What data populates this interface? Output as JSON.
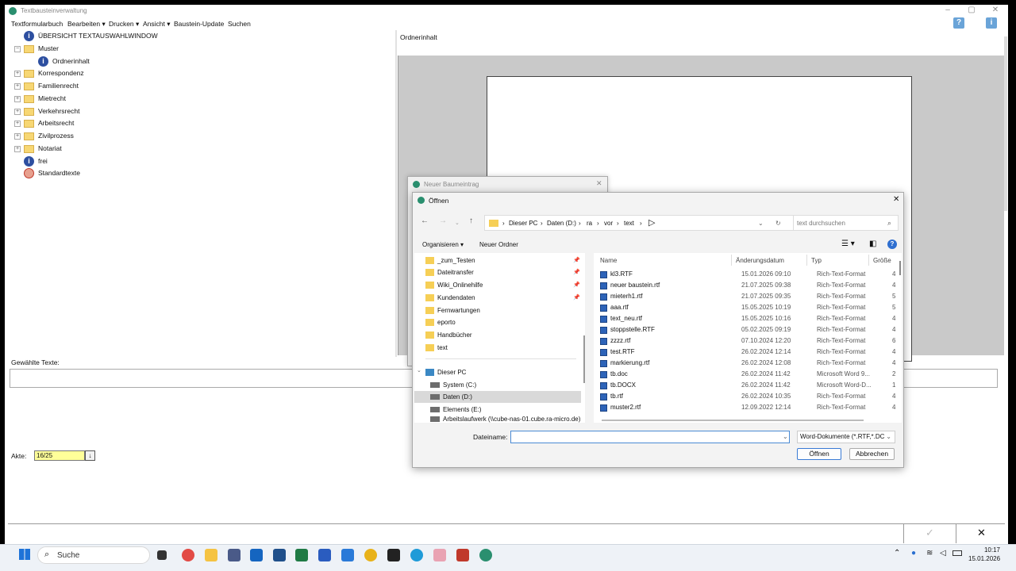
{
  "app": {
    "title": "Textbausteinverwaltung",
    "menu": [
      "Textformularbuch",
      "Bearbeiten ▾",
      "Drucken ▾",
      "Ansicht ▾",
      "Baustein-Update",
      "Suchen"
    ],
    "tree": [
      {
        "label": "ÜBERSICHT TEXTAUSWAHLWINDOW",
        "icon": "info-icon"
      },
      {
        "label": "Muster",
        "icon": "folder-open-icon"
      },
      {
        "label": "Ordnerinhalt",
        "icon": "info-icon"
      },
      {
        "label": "Korrespondenz",
        "icon": "folder-icon"
      },
      {
        "label": "Familienrecht",
        "icon": "folder-icon"
      },
      {
        "label": "Mietrecht",
        "icon": "folder-icon"
      },
      {
        "label": "Verkehrsrecht",
        "icon": "folder-icon"
      },
      {
        "label": "Arbeitsrecht",
        "icon": "folder-icon"
      },
      {
        "label": "Zivilprozess",
        "icon": "folder-icon"
      },
      {
        "label": "Notariat",
        "icon": "folder-icon"
      },
      {
        "label": "frei",
        "icon": "info-icon"
      },
      {
        "label": "Standardtexte",
        "icon": "standard-texts-icon"
      }
    ],
    "right_title": "Ordnerinhalt",
    "selected_label": "Gewählte Texte:",
    "akte_label": "Akte:",
    "akte_value": "16/25"
  },
  "nbe_window": {
    "title": "Neuer Baumeintrag"
  },
  "dialog": {
    "title": "Öffnen",
    "path": [
      "Dieser PC",
      "Daten (D:)",
      "ra",
      "vor",
      "text"
    ],
    "search_placeholder": "text durchsuchen",
    "organize": "Organisieren ▾",
    "new_folder": "Neuer Ordner",
    "nav_items": [
      {
        "label": "_zum_Testen",
        "type": "folder",
        "pinned": true
      },
      {
        "label": "Dateitransfer",
        "type": "folder",
        "pinned": true
      },
      {
        "label": "Wiki_Onlinehilfe",
        "type": "folder",
        "pinned": true
      },
      {
        "label": "Kundendaten",
        "type": "folder",
        "pinned": true
      },
      {
        "label": "Fernwartungen",
        "type": "folder",
        "pinned": false
      },
      {
        "label": "eporto",
        "type": "folder",
        "pinned": false
      },
      {
        "label": "Handbücher",
        "type": "folder",
        "pinned": false
      },
      {
        "label": "text",
        "type": "folder",
        "pinned": false
      },
      {
        "label": "Dieser PC",
        "type": "pc",
        "pinned": false
      },
      {
        "label": "System (C:)",
        "type": "drive",
        "pinned": false
      },
      {
        "label": "Daten (D:)",
        "type": "drive",
        "pinned": false
      },
      {
        "label": "Elements (E:)",
        "type": "drive",
        "pinned": false
      },
      {
        "label": "Arbeitslaufwerk (\\\\cube-nas-01.cube.ra-micro.de)",
        "type": "drive",
        "pinned": false
      }
    ],
    "columns": [
      "Name",
      "Änderungsdatum",
      "Typ",
      "Größe"
    ],
    "files": [
      [
        "kl3.RTF",
        "15.01.2026 09:10",
        "Rich-Text-Format",
        "4"
      ],
      [
        "neuer baustein.rtf",
        "21.07.2025 09:38",
        "Rich-Text-Format",
        "4"
      ],
      [
        "mieterh1.rtf",
        "21.07.2025 09:35",
        "Rich-Text-Format",
        "5"
      ],
      [
        "aaa.rtf",
        "15.05.2025 10:19",
        "Rich-Text-Format",
        "5"
      ],
      [
        "text_neu.rtf",
        "15.05.2025 10:16",
        "Rich-Text-Format",
        "4"
      ],
      [
        "stoppstelle.RTF",
        "05.02.2025 09:19",
        "Rich-Text-Format",
        "4"
      ],
      [
        "zzzz.rtf",
        "07.10.2024 12:20",
        "Rich-Text-Format",
        "6"
      ],
      [
        "test.RTF",
        "26.02.2024 12:14",
        "Rich-Text-Format",
        "4"
      ],
      [
        "markierung.rtf",
        "26.02.2024 12:08",
        "Rich-Text-Format",
        "4"
      ],
      [
        "tb.doc",
        "26.02.2024 11:42",
        "Microsoft Word 9...",
        "2"
      ],
      [
        "tb.DOCX",
        "26.02.2024 11:42",
        "Microsoft Word-D...",
        "1"
      ],
      [
        "tb.rtf",
        "26.02.2024 10:35",
        "Rich-Text-Format",
        "4"
      ],
      [
        "muster2.rtf",
        "12.09.2022 12:14",
        "Rich-Text-Format",
        "4"
      ]
    ],
    "filename_label": "Dateiname:",
    "filename_value": "",
    "filetype": "Word-Dokumente (*.RTF,*.DC",
    "open_btn": "Öffnen",
    "cancel_btn": "Abbrechen"
  },
  "taskbar": {
    "search_label": "Suche",
    "time": "10:17",
    "date": "15.01.2026"
  }
}
